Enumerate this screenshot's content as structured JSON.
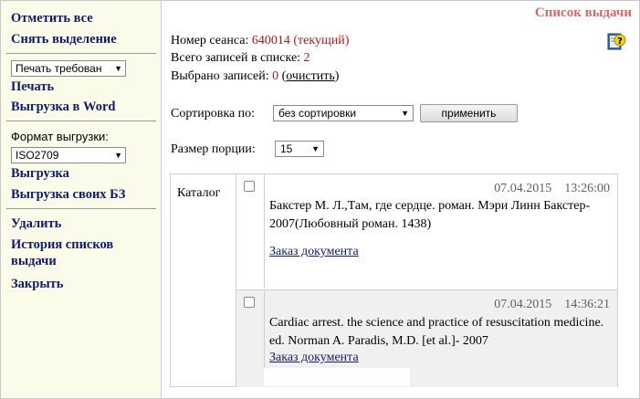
{
  "sidebar": {
    "select_all": "Отметить все",
    "deselect": "Снять выделение",
    "print_select": "Печать требован",
    "print": "Печать",
    "export_word": "Выгрузка в Word",
    "format_label": "Формат выгрузки:",
    "format_select": "ISO2709",
    "export": "Выгрузка",
    "export_own": "Выгрузка своих БЗ",
    "delete": "Удалить",
    "history": "История списков выдачи",
    "close": "Закрыть"
  },
  "header": {
    "title": "Список выдачи",
    "help_icon": "help-book-icon"
  },
  "info": {
    "session_label": "Номер сеанса:",
    "session_value": "640014 (текущий)",
    "total_label": "Всего записей в списке:",
    "total_value": "2",
    "selected_label": "Выбрано записей:",
    "selected_value": "0",
    "clear_link": "очистить"
  },
  "controls": {
    "sort_label": "Сортировка по:",
    "sort_value": "без сортировки",
    "apply_label": "применить",
    "portion_label": "Размер порции:",
    "portion_value": "15"
  },
  "table": {
    "catalog_label": "Каталог",
    "rows": [
      {
        "date": "07.04.2015",
        "time": "13:26:00",
        "text": "Бакстер М. Л.,Там, где сердце. роман. Мэри Линн Бакстер- 2007(Любовный роман. 1438)",
        "order": "Заказ документа"
      },
      {
        "date": "07.04.2015",
        "time": "14:36:21",
        "text": "Cardiac arrest. the science and practice of resuscitation medicine. ed. Norman A. Paradis, M.D. [et al.]- 2007",
        "order": "Заказ документа"
      }
    ]
  }
}
